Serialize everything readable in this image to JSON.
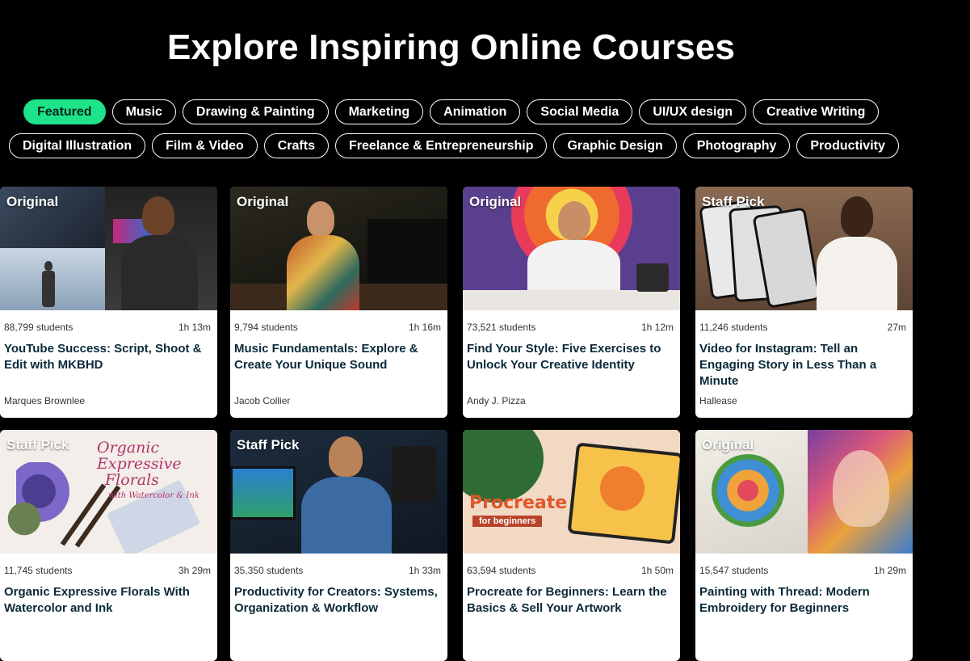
{
  "header": {
    "title": "Explore Inspiring Online Courses"
  },
  "categories_row1": [
    "Featured",
    "Music",
    "Drawing & Painting",
    "Marketing",
    "Animation",
    "Social Media",
    "UI/UX design",
    "Creative Writing"
  ],
  "categories_row2": [
    "Digital Illustration",
    "Film & Video",
    "Crafts",
    "Freelance & Entrepreneurship",
    "Graphic Design",
    "Photography",
    "Productivity"
  ],
  "active_category": "Featured",
  "colors": {
    "accent": "#1de38a",
    "background": "#000000",
    "title_text": "#0a2a3a"
  },
  "courses": [
    {
      "badge": "Original",
      "students": "88,799 students",
      "duration": "1h 13m",
      "title": "YouTube Success: Script, Shoot & Edit with MKBHD",
      "author": "Marques Brownlee"
    },
    {
      "badge": "Original",
      "students": "9,794 students",
      "duration": "1h 16m",
      "title": "Music Fundamentals: Explore & Create Your Unique Sound",
      "author": "Jacob Collier"
    },
    {
      "badge": "Original",
      "students": "73,521 students",
      "duration": "1h 12m",
      "title": "Find Your Style: Five Exercises to Unlock Your Creative Identity",
      "author": "Andy J. Pizza"
    },
    {
      "badge": "Staff Pick",
      "students": "11,246 students",
      "duration": "27m",
      "title": "Video for Instagram: Tell an Engaging Story in Less Than a Minute",
      "author": "Hallease"
    },
    {
      "badge": "Staff Pick",
      "students": "11,745 students",
      "duration": "3h 29m",
      "title": "Organic Expressive Florals With Watercolor and Ink",
      "author": ""
    },
    {
      "badge": "Staff Pick",
      "students": "35,350 students",
      "duration": "1h 33m",
      "title": "Productivity for Creators: Systems, Organization & Workflow",
      "author": ""
    },
    {
      "badge": "",
      "students": "63,594 students",
      "duration": "1h 50m",
      "title": "Procreate for Beginners: Learn the Basics & Sell Your Artwork",
      "author": ""
    },
    {
      "badge": "Original",
      "students": "15,547 students",
      "duration": "1h 29m",
      "title": "Painting with Thread: Modern Embroidery for Beginners",
      "author": ""
    }
  ],
  "thumb_text": {
    "florals_line1": "Organic Expressive",
    "florals_line2": "Florals",
    "florals_line3": "with Watercolor & Ink",
    "procreate": "Procreate",
    "procreate_sub": "for beginners"
  }
}
